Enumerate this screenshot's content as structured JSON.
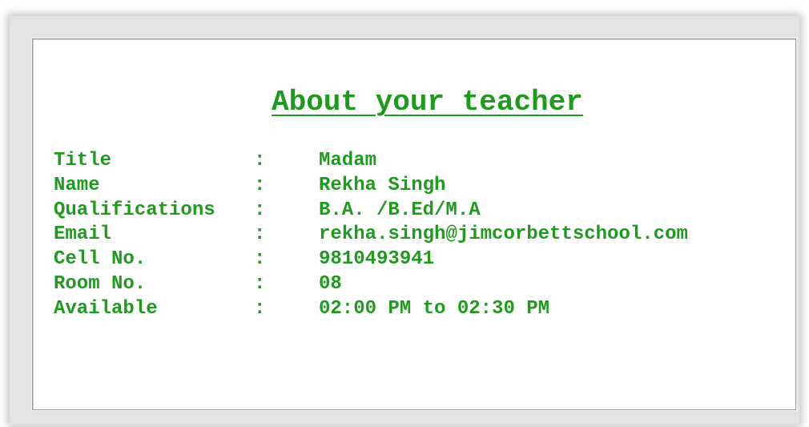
{
  "heading": "About your teacher",
  "separator": ":",
  "rows": [
    {
      "label": "Title",
      "value": "Madam"
    },
    {
      "label": "Name",
      "value": "Rekha Singh"
    },
    {
      "label": "Qualifications",
      "value": "B.A. /B.Ed/M.A"
    },
    {
      "label": "Email",
      "value": "rekha.singh@jimcorbettschool.com"
    },
    {
      "label": "Cell No.",
      "value": "9810493941"
    },
    {
      "label": "Room No.",
      "value": "08"
    },
    {
      "label": "Available",
      "value": "02:00 PM to 02:30 PM"
    }
  ],
  "colors": {
    "text": "#1f9a1f",
    "frame": "#e3e3df",
    "panel": "#ffffff"
  }
}
